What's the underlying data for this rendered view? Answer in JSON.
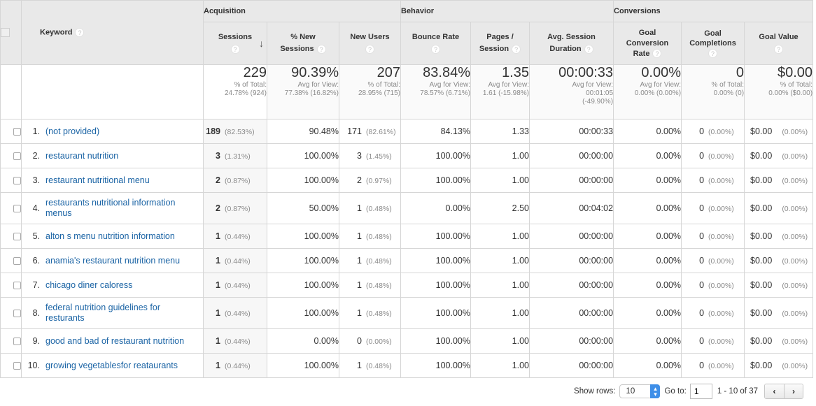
{
  "header": {
    "groups": {
      "acquisition": "Acquisition",
      "behavior": "Behavior",
      "conversions": "Conversions"
    },
    "columns": {
      "keyword": "Keyword",
      "sessions": "Sessions",
      "pct_new_sessions_l1": "% New",
      "pct_new_sessions_l2": "Sessions",
      "new_users": "New Users",
      "bounce_rate": "Bounce Rate",
      "pages_session_l1": "Pages /",
      "pages_session_l2": "Session",
      "avg_duration_l1": "Avg. Session",
      "avg_duration_l2": "Duration",
      "goal_conv_l1": "Goal",
      "goal_conv_l2": "Conversion",
      "goal_conv_l3": "Rate",
      "goal_compl_l1": "Goal",
      "goal_compl_l2": "Completions",
      "goal_value": "Goal Value"
    },
    "help_glyph": "?",
    "sort_glyph": "↓"
  },
  "summary": {
    "sessions": {
      "value": "229",
      "l1": "% of Total:",
      "l2": "24.78% (924)"
    },
    "pct_new_sessions": {
      "value": "90.39%",
      "l1": "Avg for View:",
      "l2": "77.38% (16.82%)"
    },
    "new_users": {
      "value": "207",
      "l1": "% of Total:",
      "l2": "28.95% (715)"
    },
    "bounce_rate": {
      "value": "83.84%",
      "l1": "Avg for View:",
      "l2": "78.57% (6.71%)"
    },
    "pages_session": {
      "value": "1.35",
      "l1": "Avg for View:",
      "l2": "1.61 (-15.98%)"
    },
    "avg_duration": {
      "value": "00:00:33",
      "l1": "Avg for View:",
      "l2": "00:01:05",
      "l3": "(-49.90%)"
    },
    "goal_conv": {
      "value": "0.00%",
      "l1": "Avg for View:",
      "l2": "0.00% (0.00%)"
    },
    "goal_compl": {
      "value": "0",
      "l1": "% of Total:",
      "l2": "0.00% (0)"
    },
    "goal_value": {
      "value": "$0.00",
      "l1": "% of Total:",
      "l2": "0.00% ($0.00)"
    }
  },
  "rows": [
    {
      "idx": "1.",
      "kw": "(not provided)",
      "sessions": "189",
      "sessions_pct": "(82.53%)",
      "pct_new": "90.48%",
      "new_users": "171",
      "new_users_pct": "(82.61%)",
      "bounce": "84.13%",
      "pages": "1.33",
      "duration": "00:00:33",
      "goal_conv": "0.00%",
      "goal_compl": "0",
      "goal_compl_pct": "(0.00%)",
      "goal_value": "$0.00",
      "goal_value_pct": "(0.00%)"
    },
    {
      "idx": "2.",
      "kw": "restaurant nutrition",
      "sessions": "3",
      "sessions_pct": "(1.31%)",
      "pct_new": "100.00%",
      "new_users": "3",
      "new_users_pct": "(1.45%)",
      "bounce": "100.00%",
      "pages": "1.00",
      "duration": "00:00:00",
      "goal_conv": "0.00%",
      "goal_compl": "0",
      "goal_compl_pct": "(0.00%)",
      "goal_value": "$0.00",
      "goal_value_pct": "(0.00%)"
    },
    {
      "idx": "3.",
      "kw": "restaurant nutritional menu",
      "sessions": "2",
      "sessions_pct": "(0.87%)",
      "pct_new": "100.00%",
      "new_users": "2",
      "new_users_pct": "(0.97%)",
      "bounce": "100.00%",
      "pages": "1.00",
      "duration": "00:00:00",
      "goal_conv": "0.00%",
      "goal_compl": "0",
      "goal_compl_pct": "(0.00%)",
      "goal_value": "$0.00",
      "goal_value_pct": "(0.00%)"
    },
    {
      "idx": "4.",
      "kw": "restaurants nutritional information menus",
      "sessions": "2",
      "sessions_pct": "(0.87%)",
      "pct_new": "50.00%",
      "new_users": "1",
      "new_users_pct": "(0.48%)",
      "bounce": "0.00%",
      "pages": "2.50",
      "duration": "00:04:02",
      "goal_conv": "0.00%",
      "goal_compl": "0",
      "goal_compl_pct": "(0.00%)",
      "goal_value": "$0.00",
      "goal_value_pct": "(0.00%)"
    },
    {
      "idx": "5.",
      "kw": "alton s menu nutrition information",
      "sessions": "1",
      "sessions_pct": "(0.44%)",
      "pct_new": "100.00%",
      "new_users": "1",
      "new_users_pct": "(0.48%)",
      "bounce": "100.00%",
      "pages": "1.00",
      "duration": "00:00:00",
      "goal_conv": "0.00%",
      "goal_compl": "0",
      "goal_compl_pct": "(0.00%)",
      "goal_value": "$0.00",
      "goal_value_pct": "(0.00%)"
    },
    {
      "idx": "6.",
      "kw": "anamia's restaurant nutrition menu",
      "sessions": "1",
      "sessions_pct": "(0.44%)",
      "pct_new": "100.00%",
      "new_users": "1",
      "new_users_pct": "(0.48%)",
      "bounce": "100.00%",
      "pages": "1.00",
      "duration": "00:00:00",
      "goal_conv": "0.00%",
      "goal_compl": "0",
      "goal_compl_pct": "(0.00%)",
      "goal_value": "$0.00",
      "goal_value_pct": "(0.00%)"
    },
    {
      "idx": "7.",
      "kw": "chicago diner caloress",
      "sessions": "1",
      "sessions_pct": "(0.44%)",
      "pct_new": "100.00%",
      "new_users": "1",
      "new_users_pct": "(0.48%)",
      "bounce": "100.00%",
      "pages": "1.00",
      "duration": "00:00:00",
      "goal_conv": "0.00%",
      "goal_compl": "0",
      "goal_compl_pct": "(0.00%)",
      "goal_value": "$0.00",
      "goal_value_pct": "(0.00%)"
    },
    {
      "idx": "8.",
      "kw": "federal nutrition guidelines for resturants",
      "sessions": "1",
      "sessions_pct": "(0.44%)",
      "pct_new": "100.00%",
      "new_users": "1",
      "new_users_pct": "(0.48%)",
      "bounce": "100.00%",
      "pages": "1.00",
      "duration": "00:00:00",
      "goal_conv": "0.00%",
      "goal_compl": "0",
      "goal_compl_pct": "(0.00%)",
      "goal_value": "$0.00",
      "goal_value_pct": "(0.00%)"
    },
    {
      "idx": "9.",
      "kw": "good and bad of restaurant nutrition",
      "sessions": "1",
      "sessions_pct": "(0.44%)",
      "pct_new": "0.00%",
      "new_users": "0",
      "new_users_pct": "(0.00%)",
      "bounce": "100.00%",
      "pages": "1.00",
      "duration": "00:00:00",
      "goal_conv": "0.00%",
      "goal_compl": "0",
      "goal_compl_pct": "(0.00%)",
      "goal_value": "$0.00",
      "goal_value_pct": "(0.00%)"
    },
    {
      "idx": "10.",
      "kw": "growing vegetablesfor reataurants",
      "sessions": "1",
      "sessions_pct": "(0.44%)",
      "pct_new": "100.00%",
      "new_users": "1",
      "new_users_pct": "(0.48%)",
      "bounce": "100.00%",
      "pages": "1.00",
      "duration": "00:00:00",
      "goal_conv": "0.00%",
      "goal_compl": "0",
      "goal_compl_pct": "(0.00%)",
      "goal_value": "$0.00",
      "goal_value_pct": "(0.00%)"
    }
  ],
  "footer": {
    "show_rows_label": "Show rows:",
    "show_rows_value": "10",
    "goto_label": "Go to:",
    "goto_value": "1",
    "range_text": "1 - 10 of 37",
    "prev_glyph": "‹",
    "next_glyph": "›",
    "spin_up": "⌃",
    "spin_down": "⌄"
  },
  "colors": {
    "link": "#1b64a5",
    "header_bg": "#e9e9e9",
    "border": "#d6d6d6",
    "muted": "#8a8a8a",
    "select_accent": "#3f8fe8"
  }
}
